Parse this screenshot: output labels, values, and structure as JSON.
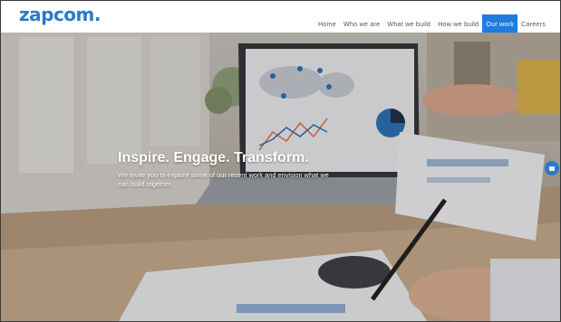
{
  "header": {
    "logo_text": "zapcom",
    "logo_dot": ".",
    "nav": [
      {
        "label": "Home"
      },
      {
        "label": "Who we are"
      },
      {
        "label": "What we build"
      },
      {
        "label": "How we build"
      },
      {
        "label": "Our work",
        "active": true
      },
      {
        "label": "Careers"
      }
    ]
  },
  "hero": {
    "headline": "Inspire. Engage. Transform.",
    "subtext": "We invite you to explore some of our recent work and envision what we can build together."
  },
  "colors": {
    "brand": "#2a7bc8",
    "nav_active_bg": "#1e7be0"
  },
  "icons": {
    "chat": "chat-bubble-icon"
  }
}
